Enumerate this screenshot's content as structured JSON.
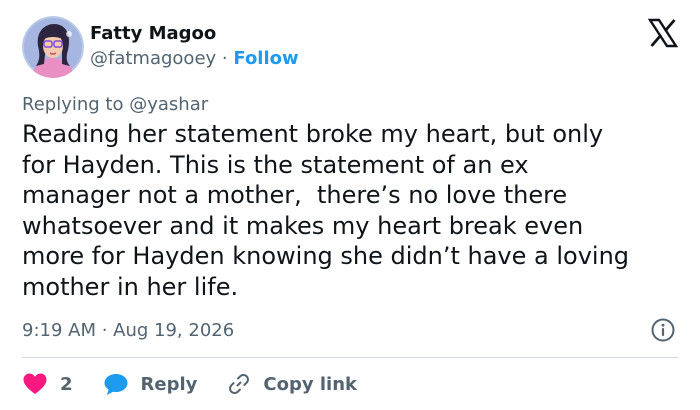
{
  "author": {
    "display_name": "Fatty Magoo",
    "handle": "@fatmagooey",
    "separator": "·",
    "follow_label": "Follow"
  },
  "icons": {
    "logo": "x-logo-icon",
    "info": "info-icon",
    "like": "heart-icon",
    "reply": "speech-bubble-icon",
    "copy": "link-icon"
  },
  "reply_context": {
    "prefix": "Replying to",
    "mention": "@yashar"
  },
  "tweet": {
    "text": "Reading her statement broke my heart, but only\nfor Hayden. This is the statement of an ex\nmanager not a mother,  there’s no love there\nwhatsoever and it makes my heart break even\nmore for Hayden knowing she didn’t have a loving\nmother in her life.",
    "timestamp": "9:19 AM · Aug 19, 2026"
  },
  "actions": {
    "like_count": "2",
    "reply_label": "Reply",
    "copy_label": "Copy link"
  },
  "colors": {
    "accent": "#1d9bf0",
    "like": "#f91880",
    "muted": "#536471",
    "text": "#0f1419",
    "divider": "#cfd9de"
  }
}
